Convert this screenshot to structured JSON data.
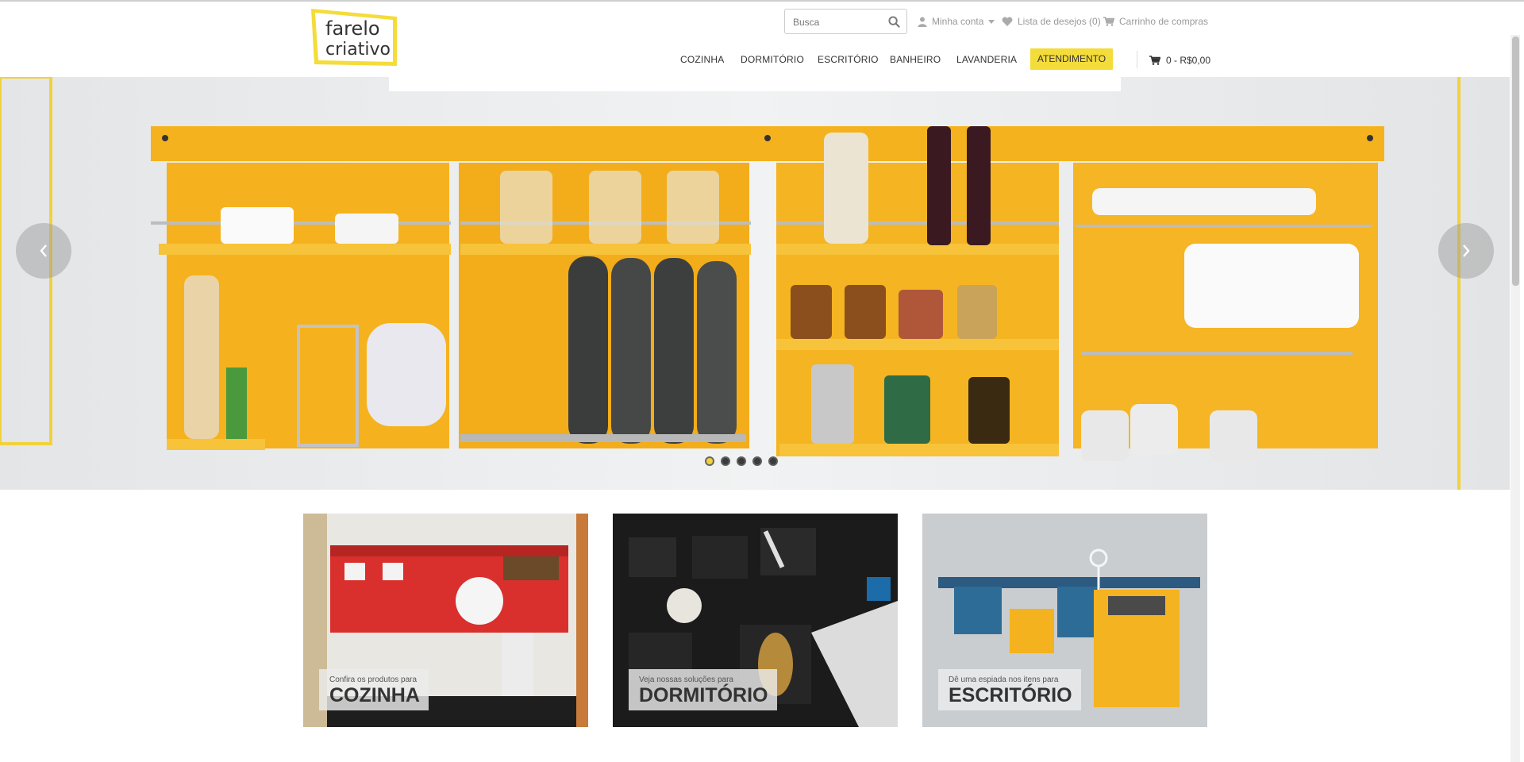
{
  "brand": {
    "line1": "farelo",
    "line2": "criativo",
    "accent": "#f4dc3a"
  },
  "search": {
    "placeholder": "Busca"
  },
  "toplinks": {
    "account": "Minha conta",
    "wishlist": "Lista de desejos (0)",
    "cart": "Carrinho de compras"
  },
  "nav": {
    "items": [
      "COZINHA",
      "DORMITÓRIO",
      "ESCRITÓRIO",
      "BANHEIRO",
      "LAVANDERIA"
    ],
    "cta": "ATENDIMENTO",
    "cart_total": "0 - R$0,00"
  },
  "slider": {
    "slides": 5,
    "active": 1,
    "prev_icon": "chevron-left-icon",
    "next_icon": "chevron-right-icon"
  },
  "categories": [
    {
      "small": "Confira os produtos para",
      "big": "COZINHA"
    },
    {
      "small": "Veja nossas soluções para",
      "big": "DORMITÓRIO"
    },
    {
      "small": "Dê uma espiada nos itens para",
      "big": "ESCRITÓRIO"
    }
  ]
}
